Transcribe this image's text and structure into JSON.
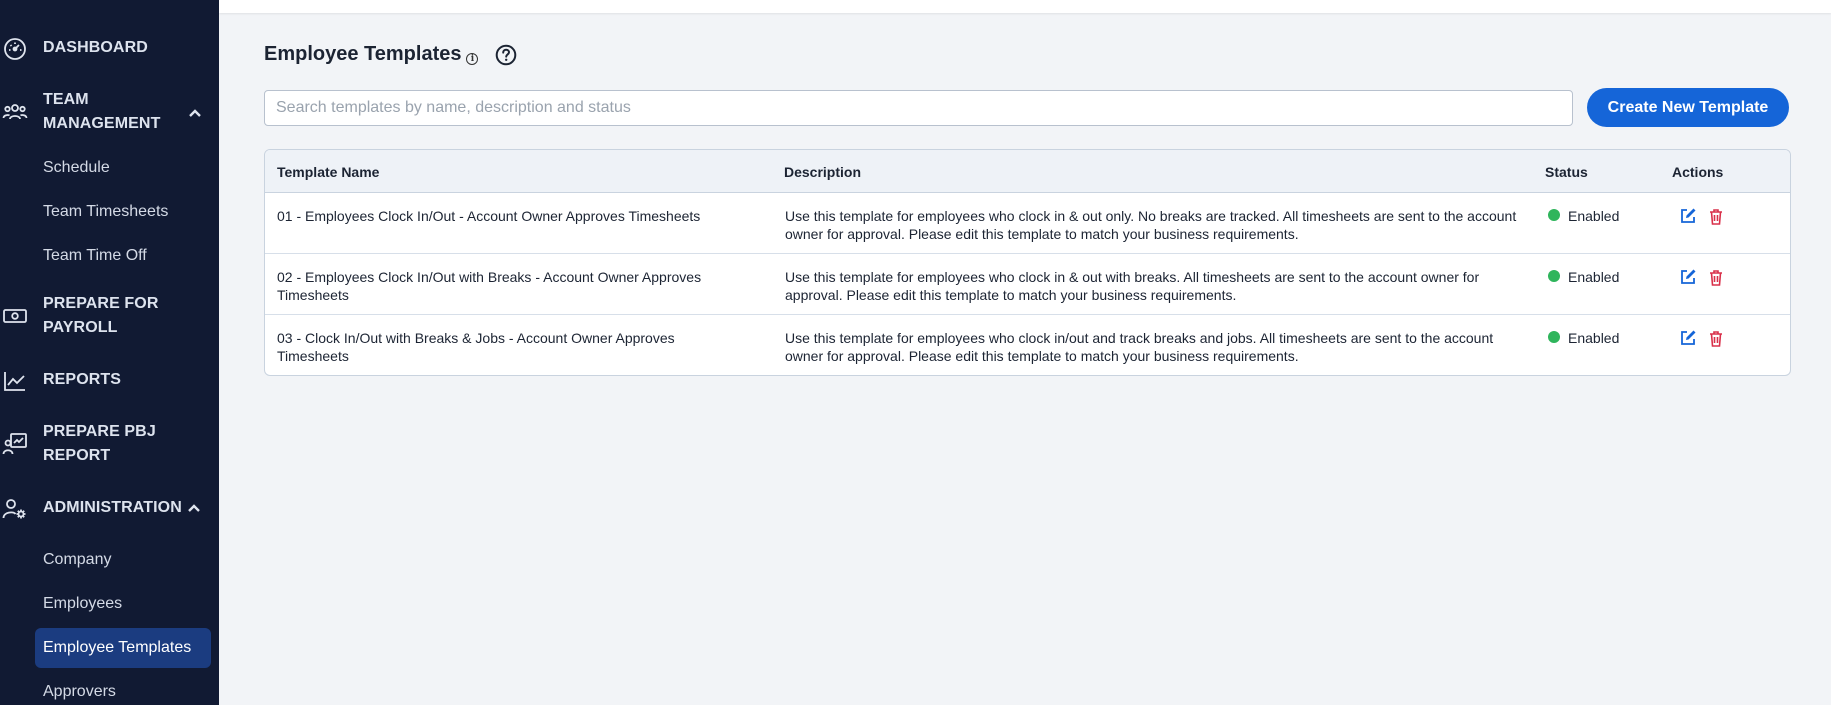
{
  "sidebar": {
    "dashboard": "DASHBOARD",
    "team_management": {
      "line1": "TEAM",
      "line2": "MANAGEMENT"
    },
    "team_items": [
      "Schedule",
      "Team Timesheets",
      "Team Time Off"
    ],
    "prepare_payroll": {
      "line1": "PREPARE FOR",
      "line2": "PAYROLL"
    },
    "reports": "REPORTS",
    "prepare_pbj": {
      "line1": "PREPARE PBJ",
      "line2": "REPORT"
    },
    "administration": "ADMINISTRATION",
    "admin_items": [
      "Company",
      "Employees",
      "Employee Templates",
      "Approvers"
    ]
  },
  "page": {
    "title": "Employee Templates",
    "info_glyph": "i"
  },
  "search": {
    "placeholder": "Search templates by name, description and status",
    "value": ""
  },
  "create_button": "Create New Template",
  "table": {
    "headers": {
      "name": "Template Name",
      "description": "Description",
      "status": "Status",
      "actions": "Actions"
    },
    "rows": [
      {
        "name": "01 - Employees Clock In/Out - Account Owner Approves Timesheets",
        "description": "Use this template for employees who clock in & out only. No breaks are tracked. All timesheets are sent to the account owner for approval. Please edit this template to match your business requirements.",
        "status": "Enabled"
      },
      {
        "name": "02 - Employees Clock In/Out with Breaks - Account Owner Approves Timesheets",
        "description": "Use this template for employees who clock in & out with breaks. All timesheets are sent to the account owner for approval. Please edit this template to match your business requirements.",
        "status": "Enabled"
      },
      {
        "name": "03 - Clock In/Out with Breaks & Jobs - Account Owner Approves Timesheets",
        "description": "Use this template for employees who clock in/out and track breaks and jobs. All timesheets are sent to the account owner for approval. Please edit this template to match your business requirements.",
        "status": "Enabled"
      }
    ]
  },
  "colors": {
    "sidebar_bg": "#111a33",
    "active_item_bg": "#1b3c80",
    "primary": "#1565d8",
    "status_enabled": "#2fb55c",
    "delete": "#d9304a"
  },
  "icons": {
    "dashboard": "speedometer-icon",
    "team_management": "people-icon",
    "prepare_payroll": "money-icon",
    "reports": "chart-line-icon",
    "prepare_pbj": "report-icon",
    "administration": "user-gear-icon",
    "help": "question-circle-icon",
    "edit": "edit-icon",
    "delete": "trash-icon"
  }
}
